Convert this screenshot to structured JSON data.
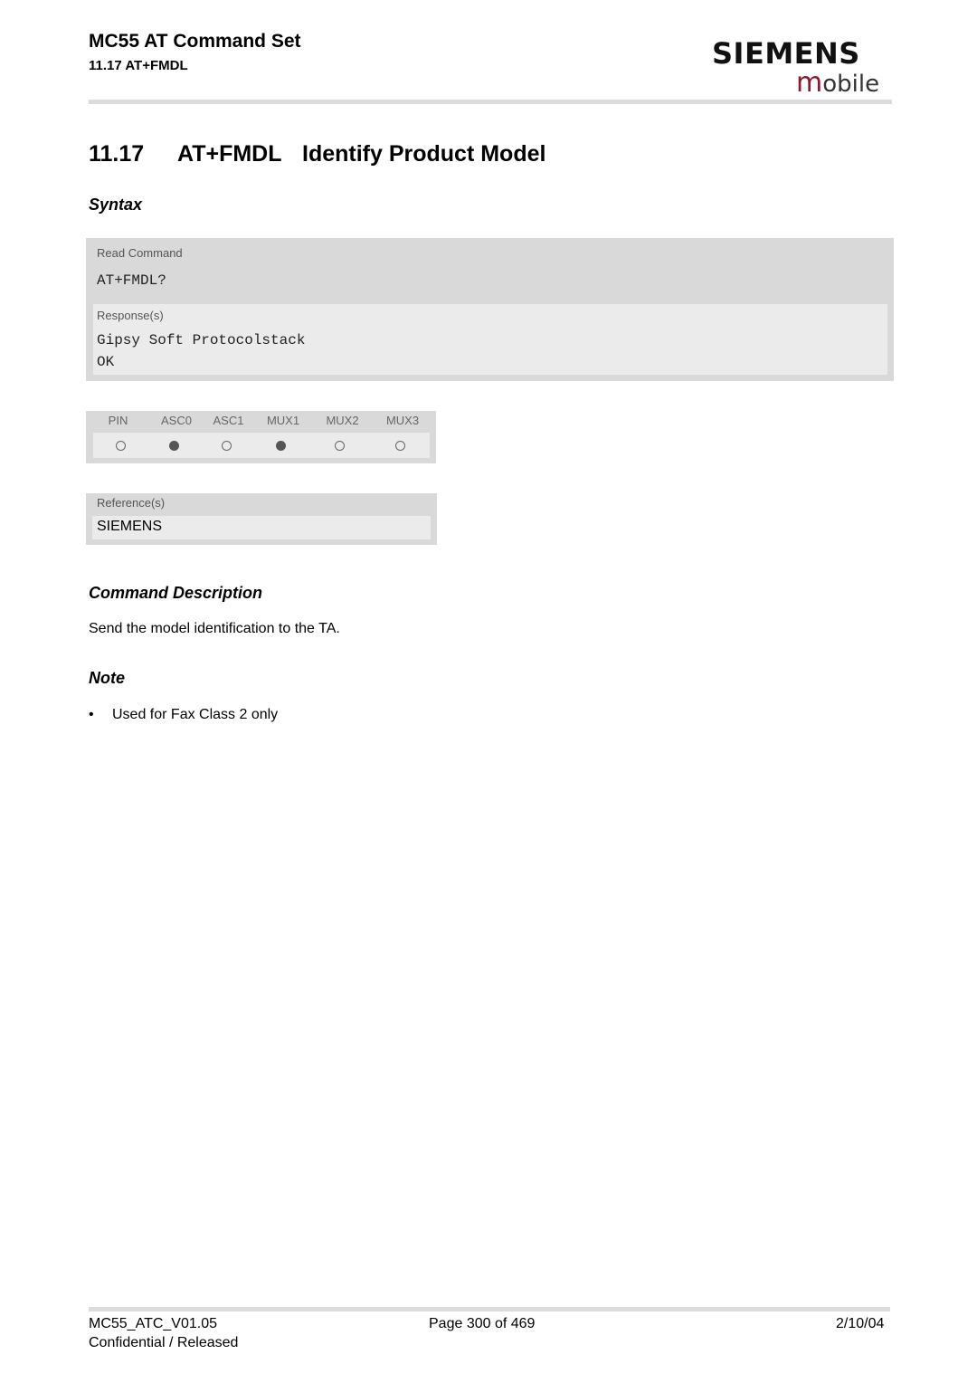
{
  "header": {
    "doc_title": "MC55 AT Command Set",
    "section_ref": "11.17 AT+FMDL",
    "logo": {
      "brand": "SIEMENS",
      "mobile_initial": "m",
      "mobile_rest": "obile",
      "accent_color": "#8b1a2e"
    }
  },
  "heading": {
    "number": "11.17",
    "command": "AT+FMDL",
    "title": "Identify Product Model"
  },
  "syntax": {
    "heading": "Syntax",
    "read_command_label": "Read Command",
    "read_command": "AT+FMDL?",
    "responses_label": "Response(s)",
    "responses": [
      "Gipsy Soft Protocolstack",
      "OK"
    ]
  },
  "interfaces": {
    "columns": [
      {
        "label": "PIN",
        "supported": false
      },
      {
        "label": "ASC0",
        "supported": true
      },
      {
        "label": "ASC1",
        "supported": false
      },
      {
        "label": "MUX1",
        "supported": true
      },
      {
        "label": "MUX2",
        "supported": false
      },
      {
        "label": "MUX3",
        "supported": false
      }
    ]
  },
  "references": {
    "label": "Reference(s)",
    "value": "SIEMENS"
  },
  "description": {
    "heading": "Command Description",
    "text": "Send the model identification to the TA."
  },
  "note": {
    "heading": "Note",
    "items": [
      "Used for Fax Class 2 only"
    ]
  },
  "footer": {
    "doc_id": "MC55_ATC_V01.05",
    "classification": "Confidential / Released",
    "page": "Page 300 of 469",
    "date": "2/10/04"
  }
}
